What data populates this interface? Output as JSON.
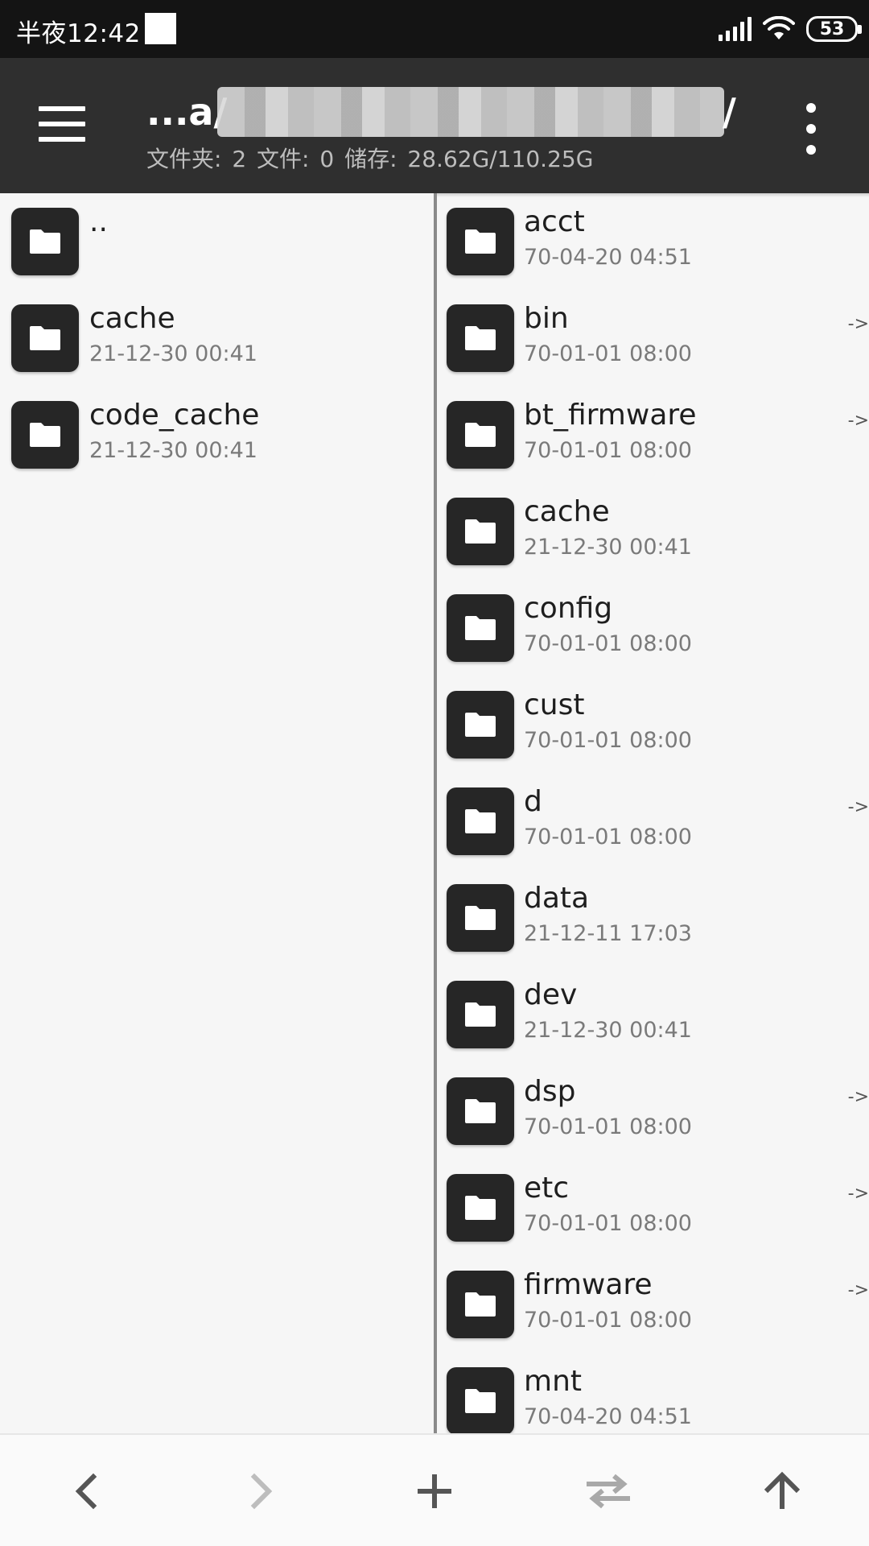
{
  "status_bar": {
    "time": "半夜12:42",
    "battery": "53"
  },
  "app_bar": {
    "path_prefix": "...a/",
    "path_suffix": "/",
    "subtitle": "文件夹: 2  文件: 0  储存: 28.62G/110.25G"
  },
  "left_pane": {
    "items": [
      {
        "name": "..",
        "date": ""
      },
      {
        "name": "cache",
        "date": "21-12-30 00:41"
      },
      {
        "name": "code_cache",
        "date": "21-12-30 00:41"
      }
    ]
  },
  "right_pane": {
    "link_marker": "->",
    "items": [
      {
        "name": "acct",
        "date": "70-04-20 04:51",
        "link": false
      },
      {
        "name": "bin",
        "date": "70-01-01 08:00",
        "link": true
      },
      {
        "name": "bt_firmware",
        "date": "70-01-01 08:00",
        "link": true
      },
      {
        "name": "cache",
        "date": "21-12-30 00:41",
        "link": false
      },
      {
        "name": "config",
        "date": "70-01-01 08:00",
        "link": false
      },
      {
        "name": "cust",
        "date": "70-01-01 08:00",
        "link": false
      },
      {
        "name": "d",
        "date": "70-01-01 08:00",
        "link": true
      },
      {
        "name": "data",
        "date": "21-12-11 17:03",
        "link": false
      },
      {
        "name": "dev",
        "date": "21-12-30 00:41",
        "link": false
      },
      {
        "name": "dsp",
        "date": "70-01-01 08:00",
        "link": true
      },
      {
        "name": "etc",
        "date": "70-01-01 08:00",
        "link": true
      },
      {
        "name": "firmware",
        "date": "70-01-01 08:00",
        "link": true
      },
      {
        "name": "mnt",
        "date": "70-04-20 04:51",
        "link": false
      }
    ]
  },
  "toolbar": {
    "icons": [
      "back-icon",
      "forward-icon",
      "add-icon",
      "swap-panes-icon",
      "up-directory-icon"
    ],
    "colors": {
      "active": "#555555",
      "disabled": "#bdbdbd"
    }
  }
}
